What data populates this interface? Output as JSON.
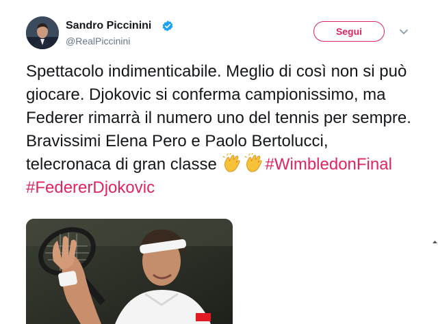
{
  "author": {
    "name": "Sandro Piccinini",
    "handle": "@RealPiccinini",
    "verified": true
  },
  "actions": {
    "follow_label": "Segui"
  },
  "tweet": {
    "text_plain": "Spettacolo indimenticabile. Meglio di così non si può giocare. Djokovic si conferma campionissimo, ma Federer rimarrà il numero uno del tennis per sempre. Bravissimi Elena Pero e Paolo Bertolucci, telecronaca di gran classe ",
    "emojis": [
      "clapping-hands-emoji",
      "clapping-hands-emoji"
    ],
    "hashtags": [
      "#WimbledonFinal",
      "#FedererDjokovic"
    ]
  },
  "colors": {
    "accent": "#e0245e",
    "verified": "#1da1f2",
    "text": "#14171a",
    "muted": "#657786"
  }
}
